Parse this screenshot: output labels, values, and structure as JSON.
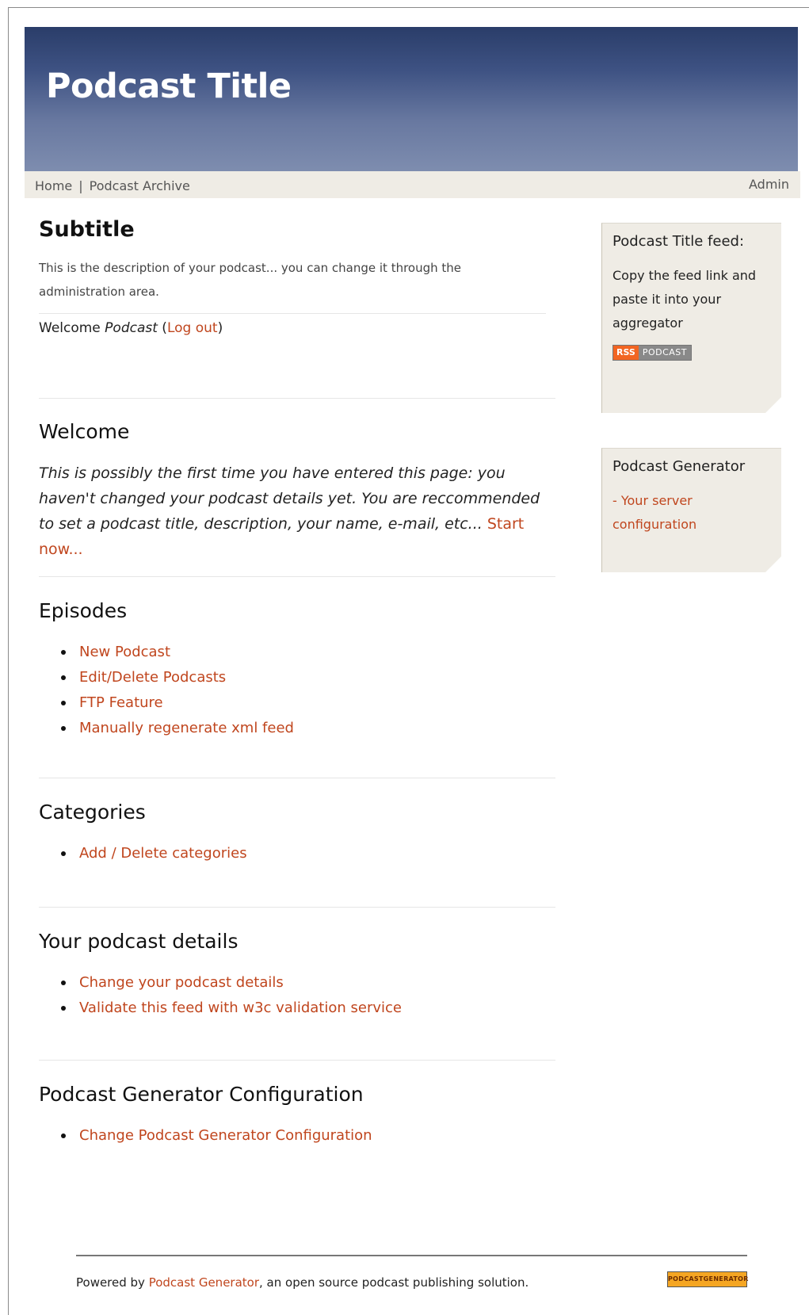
{
  "header": {
    "title": "Podcast Title"
  },
  "nav": {
    "home": "Home",
    "separator": "|",
    "archive": "Podcast Archive",
    "admin": "Admin"
  },
  "intro": {
    "subtitle": "Subtitle",
    "description": "This is the description of your podcast... you can change it through the administration area.",
    "welcome_prefix": "Welcome ",
    "welcome_user": "Podcast",
    "logout_open": " (",
    "logout": "Log out",
    "logout_close": ")"
  },
  "welcome": {
    "heading": "Welcome",
    "text": "This is possibly the first time you have entered this page: you haven't changed your podcast details yet. You are reccommended to set a podcast title, description, your name, e-mail, etc... ",
    "start_link": "Start now..."
  },
  "episodes": {
    "heading": "Episodes",
    "items": [
      "New Podcast",
      "Edit/Delete Podcasts",
      "FTP Feature",
      "Manually regenerate xml feed"
    ]
  },
  "categories": {
    "heading": "Categories",
    "items": [
      "Add / Delete categories"
    ]
  },
  "details": {
    "heading": "Your podcast details",
    "items": [
      "Change your podcast details",
      "Validate this feed with w3c validation service"
    ]
  },
  "config": {
    "heading": "Podcast Generator Configuration",
    "items": [
      "Change Podcast Generator Configuration"
    ]
  },
  "sidebar": {
    "feed_title": "Podcast Title feed:",
    "feed_text": "Copy the feed link and paste it into your aggregator",
    "rss_label": "RSS",
    "podcast_label": "PODCAST",
    "gen_title": "Podcast Generator",
    "gen_link": "- Your server configuration"
  },
  "footer": {
    "prefix": "Powered by ",
    "link": "Podcast Generator",
    "suffix": ", an open source podcast publishing solution.",
    "badge": "PODCASTGENERATOR"
  },
  "colors": {
    "link": "#c0461e",
    "header_top": "#2a3d69",
    "header_bottom": "#7e8daf",
    "nav_bg": "#efece5"
  }
}
